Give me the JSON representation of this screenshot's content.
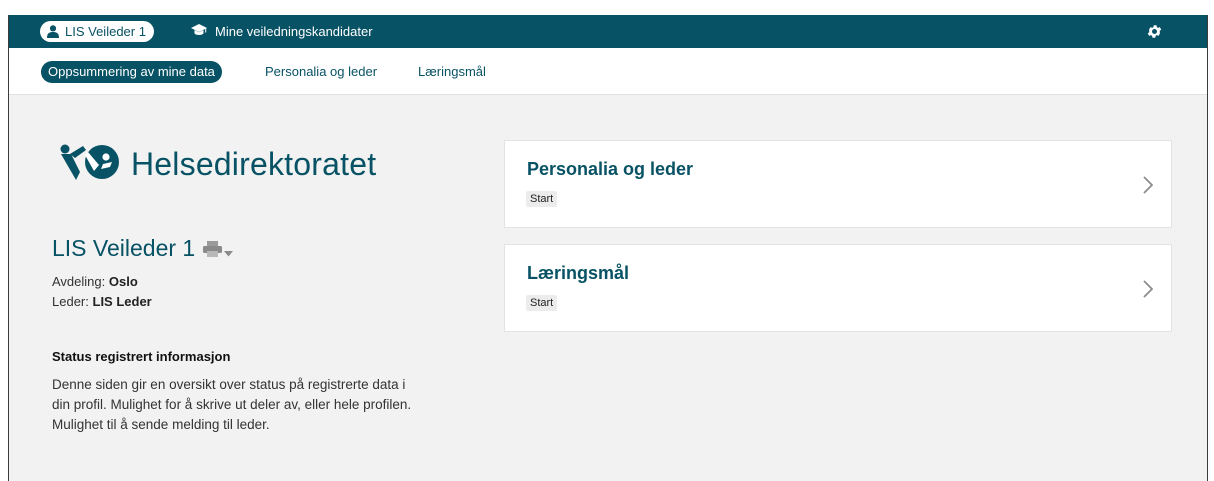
{
  "topbar": {
    "user_label": "LIS Veileder 1",
    "kandidater_label": "Mine veiledningskandidater",
    "icons": {
      "user": "user-icon",
      "kandidater": "graduation-cap-icon",
      "settings": "gear-icon"
    }
  },
  "subnav": {
    "tabs": [
      {
        "label": "Oppsummering av mine data",
        "active": true
      },
      {
        "label": "Personalia og leder",
        "active": false
      },
      {
        "label": "Læringsmål",
        "active": false
      }
    ]
  },
  "logo": {
    "text": "Helsedirektoratet"
  },
  "profile": {
    "name": "LIS Veileder 1",
    "avdeling_label": "Avdeling:",
    "avdeling_value": "Oslo",
    "leder_label": "Leder:",
    "leder_value": "LIS Leder"
  },
  "status": {
    "title": "Status registrert informasjon",
    "text": "Denne siden gir en oversikt over status på registrerte data i din profil. Mulighet for å skrive ut deler av, eller hele profilen. Mulighet til å sende melding til leder."
  },
  "cards": [
    {
      "title": "Personalia og leder",
      "badge": "Start"
    },
    {
      "title": "Læringsmål",
      "badge": "Start"
    }
  ],
  "colors": {
    "brand": "#075264",
    "background": "#f2f2f2",
    "badge": "#ececec"
  }
}
